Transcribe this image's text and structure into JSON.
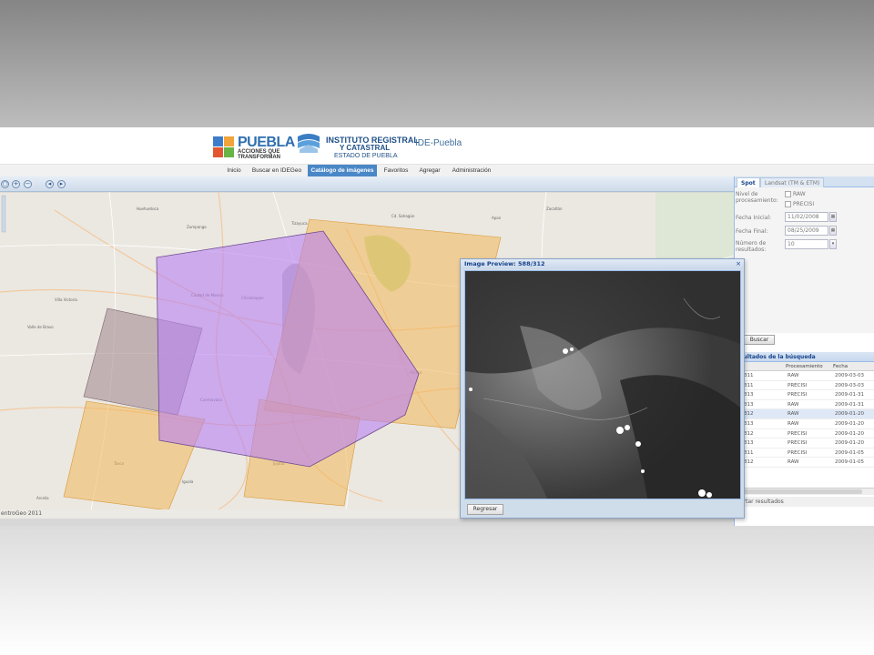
{
  "header": {
    "puebla_brand": "PUEBLA",
    "puebla_tagline": "ACCIONES QUE TRANSFORMAN",
    "irc_line1": "INSTITUTO REGISTRAL",
    "irc_line2": "Y CATASTRAL",
    "irc_line3": "ESTADO DE PUEBLA",
    "site_title": "IDE-Puebla"
  },
  "nav": {
    "items": [
      "Inicio",
      "Buscar en IDEGeo",
      "Catálogo de imágenes",
      "Favoritos",
      "Agregar",
      "Administración"
    ],
    "active": "Catálogo de imágenes"
  },
  "map": {
    "attribution": "entroGeo 2011",
    "footprint_colors": {
      "orange": "#f3b75a",
      "purple": "#b781f2",
      "brown": "#a58c95"
    }
  },
  "panel": {
    "tabs": [
      "Spot",
      "Landsat (TM & ETM)"
    ],
    "active_tab": "Spot",
    "processing_label": "Nivel de procesamiento:",
    "options": [
      "RAW",
      "PRECISI"
    ],
    "start_label": "Fecha Inicial:",
    "start_value": "11/02/2008",
    "end_label": "Fecha Final:",
    "end_value": "08/25/2009",
    "count_label": "Número de resultados:",
    "count_value": "10",
    "search_button": "Buscar",
    "results_title": "esultados de la búsqueda",
    "columns": [
      "Procesamiento",
      "Fecha"
    ],
    "rows": [
      {
        "id": "311",
        "proc": "RAW",
        "date": "2009-03-03"
      },
      {
        "id": "311",
        "proc": "PRECISI",
        "date": "2009-03-03"
      },
      {
        "id": "313",
        "proc": "PRECISI",
        "date": "2009-01-31"
      },
      {
        "id": "313",
        "proc": "RAW",
        "date": "2009-01-31"
      },
      {
        "id": "312",
        "proc": "RAW",
        "date": "2009-01-20"
      },
      {
        "id": "313",
        "proc": "RAW",
        "date": "2009-01-20"
      },
      {
        "id": "312",
        "proc": "PRECISI",
        "date": "2009-01-20"
      },
      {
        "id": "313",
        "proc": "PRECISI",
        "date": "2009-01-20"
      },
      {
        "id": "311",
        "proc": "PRECISI",
        "date": "2009-01-05"
      },
      {
        "id": "312",
        "proc": "RAW",
        "date": "2009-01-05"
      }
    ],
    "export_label": "ortar resultados"
  },
  "modal": {
    "title": "Image Preview: 588/312",
    "close": "×",
    "back_button": "Regresar"
  }
}
